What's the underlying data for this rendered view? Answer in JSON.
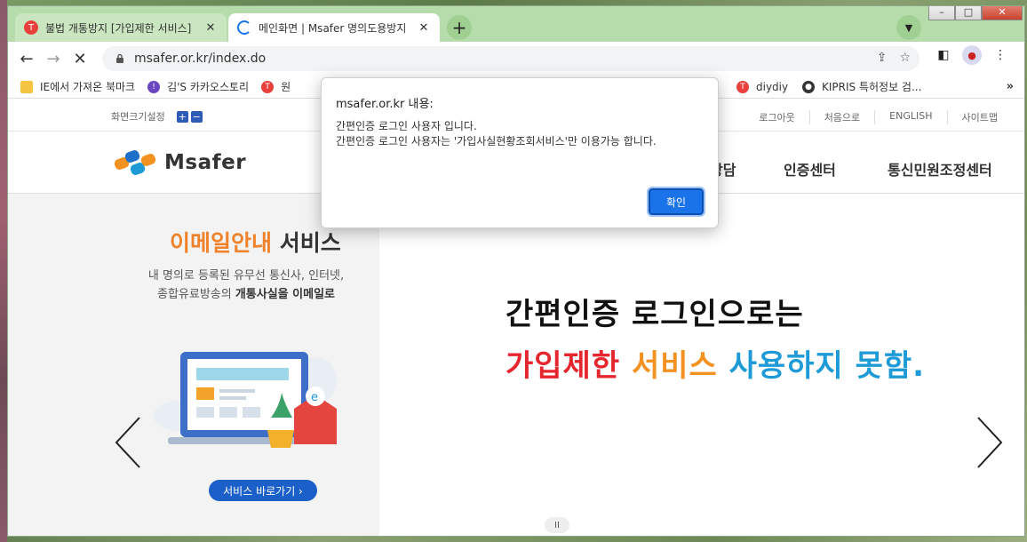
{
  "browser": {
    "tabs": [
      {
        "title": "불법 개통방지 [가입제한 서비스]",
        "active": false,
        "favicon": "red-t-icon"
      },
      {
        "title": "메인화면 | Msafer 명의도용방지",
        "active": true,
        "favicon": "loading-spinner-icon"
      }
    ],
    "url": "msafer.or.kr/index.do",
    "bookmarks": [
      {
        "label": "IE에서 가져온 북마크",
        "icon": "folder-icon"
      },
      {
        "label": "김'S 카카오스토리",
        "icon": "shield-icon"
      },
      {
        "label": "원",
        "icon": "red-t-icon"
      },
      {
        "label": "diydiy",
        "icon": "red-t-icon"
      },
      {
        "label": "KIPRIS 특허정보 검...",
        "icon": "globe-icon"
      }
    ],
    "bookmarks_more": "»",
    "new_tab": "+",
    "win_controls": [
      "–",
      "□",
      "✕"
    ]
  },
  "site": {
    "util": {
      "fontsize_label": "화면크기설정",
      "plus": "+",
      "minus": "−",
      "links": [
        "로그아웃",
        "처음으로",
        "ENGLISH",
        "사이트맵"
      ]
    },
    "logo_text": "Msafer",
    "menu": [
      "상담",
      "인증센터",
      "통신민원조정센터"
    ],
    "banner": {
      "title_accent": "이메일안내",
      "title_rest": " 서비스",
      "desc_line1": "내 명의로 등록된 유무선 통신사, 인터넷,",
      "desc_line2_plain": "종합유료방송의 ",
      "desc_line2_bold": "개통사실을 이메일로",
      "button": "서비스 바로가기 ›",
      "headline1": "간편인증 로그인으로는",
      "headline2_red": "가입제한",
      "headline2_orange": "서비스",
      "headline2_blue": "사용하지 못함.",
      "pause": "II"
    }
  },
  "dialog": {
    "title": "msafer.or.kr 내용:",
    "line1": "간편인증 로그인 사용자 입니다.",
    "line2": "간편인증 로그인 사용자는 '가입사실현황조회서비스'만 이용가능 합니다.",
    "ok": "확인"
  },
  "colors": {
    "tabstrip": "#b6dcac",
    "accent_blue": "#1a73e8",
    "orange": "#f0822a",
    "red": "#e5262f",
    "sky": "#1e9bd7"
  }
}
